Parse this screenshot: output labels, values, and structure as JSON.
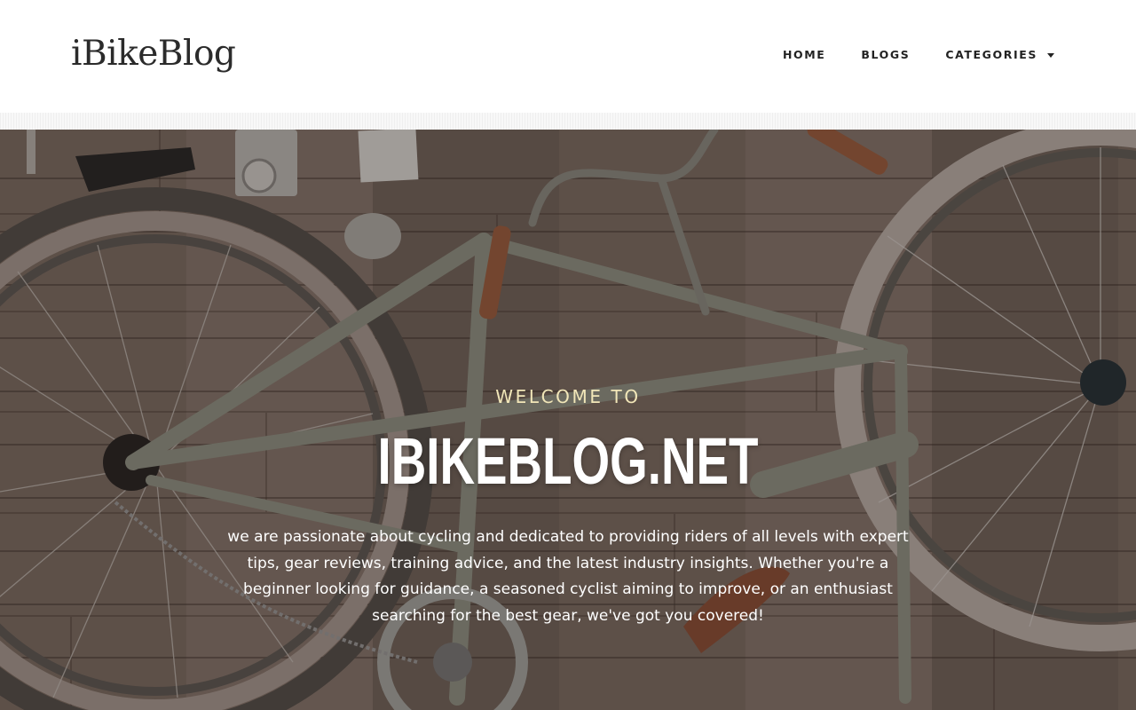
{
  "site": {
    "logo": "iBikeBlog"
  },
  "nav": {
    "items": [
      {
        "label": "HOME"
      },
      {
        "label": "BLOGS"
      },
      {
        "label": "CATEGORIES",
        "has_dropdown": true
      }
    ]
  },
  "hero": {
    "eyebrow": "WELCOME TO",
    "title": "IBIKEBLOG.NET",
    "description": "we are passionate about cycling and dedicated to providing riders of all levels with expert tips, gear reviews, training advice, and the latest industry insights. Whether you're a beginner looking for guidance, a seasoned cyclist aiming to improve, or an enthusiast searching for the best gear, we've got you covered!",
    "background_image": "bicycle-on-wooden-floor",
    "colors": {
      "eyebrow": "#f1e6b8",
      "title": "#ffffff",
      "text": "#ffffff"
    }
  },
  "icons": {
    "dropdown": "chevron-down-icon"
  }
}
